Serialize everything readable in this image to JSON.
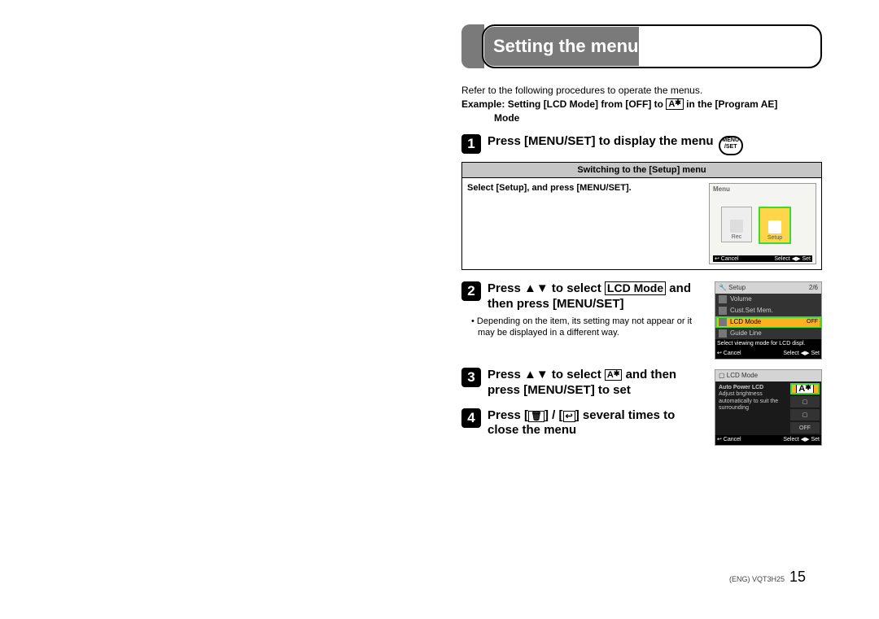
{
  "title": "Setting the menu",
  "intro": "Refer to the following procedures to operate the menus.",
  "example_line1": "Example: Setting [LCD Mode] from [OFF] to ",
  "example_line1_end": " in the [Program AE]",
  "example_line2": "Mode",
  "auto_icon_letter": "A",
  "menu_btn_top": "MENU",
  "menu_btn_bot": "/SET",
  "steps": {
    "s1": "Press [MENU/SET] to display the menu ",
    "s2a": "Press ▲▼ to select ",
    "s2b": " and then press [MENU/SET]",
    "s2_box": "LCD Mode",
    "s2_note": "Depending on the item, its setting may not appear or it may be displayed in a different way.",
    "s3a": "Press ▲▼ to select ",
    "s3b": " and then press [MENU/SET] to set",
    "s4a": "Press [",
    "s4b": "] / [",
    "s4c": "] several times to close the menu",
    "bin": "🗑",
    "ret": "↩"
  },
  "graybox": {
    "head": "Switching to the [Setup] menu",
    "body": "Select [Setup], and press [MENU/SET]."
  },
  "shot1": {
    "title": "Menu",
    "tab_rec": "Rec",
    "tab_setup": "Setup",
    "f_cancel": "↩ Cancel",
    "f_select": "Select ◀▶ Set"
  },
  "shot2": {
    "head_l": "🔧 Setup",
    "head_r": "2/6",
    "r1": "Volume",
    "r2": "Cust.Set Mem.",
    "r3": "LCD Mode",
    "r3_val": "OFF",
    "r4": "Guide Line",
    "msg": "Select viewing mode for LCD displ.",
    "f_cancel": "↩ Cancel",
    "f_select": "Select ◀▶ Set"
  },
  "shot3": {
    "head": "▢ LCD Mode",
    "title_a": "Auto Power LCD",
    "desc": "Adjust brightness automatically to suit the surrounding",
    "opt_off": "OFF",
    "f_cancel": "↩ Cancel",
    "f_select": "Select ◀▶ Set"
  },
  "footer": {
    "doc": "(ENG) VQT3H25",
    "num": "15"
  }
}
